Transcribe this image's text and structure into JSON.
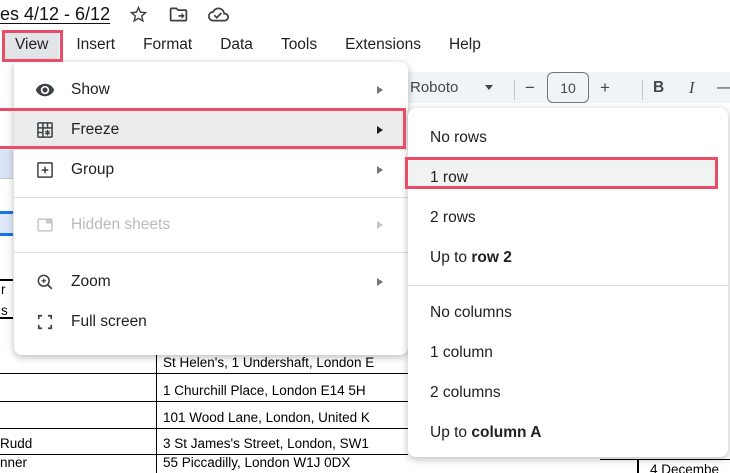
{
  "window": {
    "title": "es 4/12 - 6/12"
  },
  "menubar": {
    "items": [
      {
        "label": "View"
      },
      {
        "label": "Insert"
      },
      {
        "label": "Format"
      },
      {
        "label": "Data"
      },
      {
        "label": "Tools"
      },
      {
        "label": "Extensions"
      },
      {
        "label": "Help"
      }
    ]
  },
  "toolbar": {
    "font_family_value": "Roboto",
    "minus": "−",
    "font_size_value": "10",
    "plus": "+",
    "bold": "B",
    "italic": "I",
    "overflow_glyph": "—"
  },
  "view_menu": {
    "items": [
      {
        "label": "Show",
        "icon": "eye-icon",
        "has_submenu": true
      },
      {
        "label": "Freeze",
        "icon": "freeze-icon",
        "has_submenu": true,
        "highlighted": true
      },
      {
        "label": "Group",
        "icon": "group-icon",
        "has_submenu": true
      },
      {
        "label": "Hidden sheets",
        "icon": "hidden-sheets-icon",
        "has_submenu": true,
        "disabled": true
      },
      {
        "label": "Zoom",
        "icon": "zoom-in-icon",
        "has_submenu": true
      },
      {
        "label": "Full screen",
        "icon": "fullscreen-icon",
        "has_submenu": false
      }
    ]
  },
  "freeze_submenu": {
    "row_items": [
      {
        "label": "No rows"
      },
      {
        "label": "1 row",
        "highlighted": true
      },
      {
        "label": "2 rows"
      },
      {
        "prefix": "Up to ",
        "bold": "row 2"
      }
    ],
    "column_items": [
      {
        "label": "No columns"
      },
      {
        "label": "1 column"
      },
      {
        "label": "2 columns"
      },
      {
        "prefix": "Up to ",
        "bold": "column A"
      }
    ]
  },
  "spreadsheet": {
    "rows": [
      {
        "name": "",
        "address": "St Helen's, 1 Undershaft, London E"
      },
      {
        "name": "",
        "address": "1 Churchill Place, London E14 5H"
      },
      {
        "name": "",
        "address": "101 Wood Lane, London, United K"
      },
      {
        "name": "Rudd",
        "address": "3 St James's Street, London, SW1"
      },
      {
        "name": "nner",
        "address": "55 Piccadilly, London W1J 0DX"
      }
    ],
    "bottom_right_cell": "4 Decembe",
    "edge_fragments": {
      "a": "r",
      "b": "s"
    }
  },
  "colors": {
    "annotation_red": "#ea4c67",
    "toolbar_bg": "#f0f4f9",
    "accent_blue": "#1a73e8",
    "menu_hover_gray": "#ececec"
  }
}
